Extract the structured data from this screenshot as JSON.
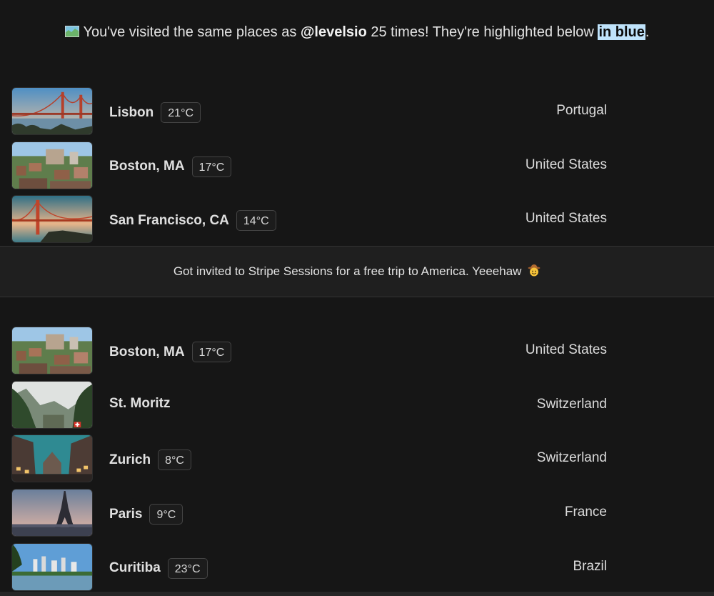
{
  "banner": {
    "icon": "map-icon",
    "prefix": "You've visited the same places as ",
    "handle": "@levelsio",
    "middle": " 25 times! They're highlighted below ",
    "highlight": "in blue",
    "suffix": "."
  },
  "colors": {
    "background": "#161616",
    "highlight": "#bfe3fb",
    "note_background": "#1f1f1f"
  },
  "trips_before": [
    {
      "city": "Lisbon",
      "temp": "21°C",
      "country": "Portugal",
      "photo": "bridge-sunset"
    },
    {
      "city": "Boston, MA",
      "temp": "17°C",
      "country": "United States",
      "photo": "city-aerial"
    },
    {
      "city": "San Francisco, CA",
      "temp": "14°C",
      "country": "United States",
      "photo": "golden-gate"
    }
  ],
  "note": {
    "text": "Got invited to Stripe Sessions for a free trip to America. Yeeehaw",
    "emoji": "cowboy-hat-face-icon"
  },
  "trips_after": [
    {
      "city": "Boston, MA",
      "temp": "17°C",
      "country": "United States",
      "photo": "city-aerial"
    },
    {
      "city": "St. Moritz",
      "temp": "",
      "country": "Switzerland",
      "photo": "mountain-valley"
    },
    {
      "city": "Zurich",
      "temp": "8°C",
      "country": "Switzerland",
      "photo": "old-town-street"
    },
    {
      "city": "Paris",
      "temp": "9°C",
      "country": "France",
      "photo": "eiffel-tower"
    },
    {
      "city": "Curitiba",
      "temp": "23°C",
      "country": "Brazil",
      "photo": "lake-skyline"
    }
  ]
}
